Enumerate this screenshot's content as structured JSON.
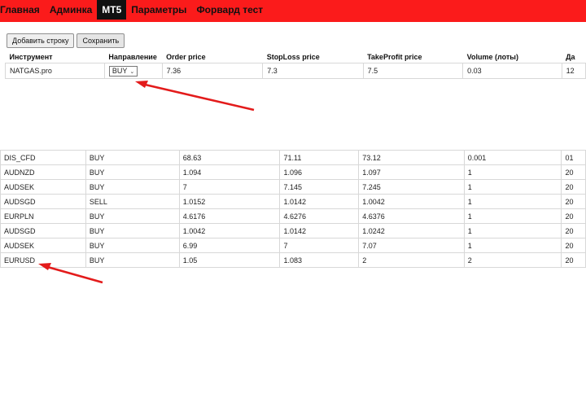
{
  "nav": {
    "items": [
      {
        "label": "Главная",
        "active": false
      },
      {
        "label": "Админка",
        "active": false
      },
      {
        "label": "MT5",
        "active": true
      },
      {
        "label": "Параметры",
        "active": false
      },
      {
        "label": "Форвард тест",
        "active": false
      }
    ],
    "bg_color": "#fb1b1b"
  },
  "toolbar": {
    "add_row_label": "Добавить строку",
    "save_label": "Сохранить"
  },
  "edit_form": {
    "headers": [
      "Инструмент",
      "Направление",
      "Order price",
      "StopLoss price",
      "TakeProfit price",
      "Volume (лоты)",
      "Да"
    ],
    "row": {
      "instrument": "NATGAS.pro",
      "direction": "BUY",
      "order_price": "7.36",
      "stoploss": "7.3",
      "takeprofit": "7.5",
      "volume": "0.03",
      "date": "12"
    }
  },
  "orders": {
    "rows": [
      [
        "DIS_CFD",
        "BUY",
        "68.63",
        "71.11",
        "73.12",
        "0.001",
        "01"
      ],
      [
        "AUDNZD",
        "BUY",
        "1.094",
        "1.096",
        "1.097",
        "1",
        "20"
      ],
      [
        "AUDSEK",
        "BUY",
        "7",
        "7.145",
        "7.245",
        "1",
        "20"
      ],
      [
        "AUDSGD",
        "SELL",
        "1.0152",
        "1.0142",
        "1.0042",
        "1",
        "20"
      ],
      [
        "EURPLN",
        "BUY",
        "4.6176",
        "4.6276",
        "4.6376",
        "1",
        "20"
      ],
      [
        "AUDSGD",
        "BUY",
        "1.0042",
        "1.0142",
        "1.0242",
        "1",
        "20"
      ],
      [
        "AUDSEK",
        "BUY",
        "6.99",
        "7",
        "7.07",
        "1",
        "20"
      ],
      [
        "EURUSD",
        "BUY",
        "1.05",
        "1.083",
        "2",
        "2",
        "20"
      ]
    ]
  },
  "annotation_color": "#e31b1b"
}
